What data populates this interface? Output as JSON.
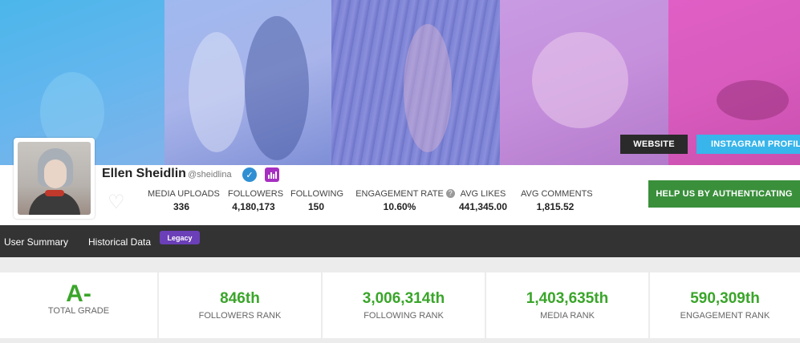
{
  "banner": {
    "website_label": "WEBSITE",
    "instagram_label": "INSTAGRAM PROFILE"
  },
  "profile": {
    "name": "Ellen Sheidlin",
    "handle": "@sheidlina",
    "verified_icon": "check",
    "stats_icon": "bar-chart"
  },
  "stats": [
    {
      "label": "MEDIA UPLOADS",
      "value": "336"
    },
    {
      "label": "FOLLOWERS",
      "value": "4,180,173"
    },
    {
      "label": "FOLLOWING",
      "value": "150"
    },
    {
      "label": "ENGAGEMENT RATE",
      "value": "10.60%"
    },
    {
      "label": "AVG LIKES",
      "value": "441,345.00"
    },
    {
      "label": "AVG COMMENTS",
      "value": "1,815.52"
    }
  ],
  "help_button_label": "HELP US BY AUTHENTICATING",
  "nav": {
    "user_summary": "User Summary",
    "historical_data": "Historical Data",
    "legacy_badge": "Legacy"
  },
  "ranks": {
    "grade_value": "A-",
    "grade_label": "TOTAL GRADE",
    "items": [
      {
        "value": "846th",
        "label": "FOLLOWERS RANK"
      },
      {
        "value": "3,006,314th",
        "label": "FOLLOWING RANK"
      },
      {
        "value": "1,403,635th",
        "label": "MEDIA RANK"
      },
      {
        "value": "590,309th",
        "label": "ENGAGEMENT RANK"
      }
    ]
  },
  "colors": {
    "accent_green": "#3aa52a",
    "button_green": "#3a8f3b",
    "instagram_blue": "#38b5ea",
    "legacy_purple": "#6b3fb8",
    "nav_dark": "#333333"
  }
}
